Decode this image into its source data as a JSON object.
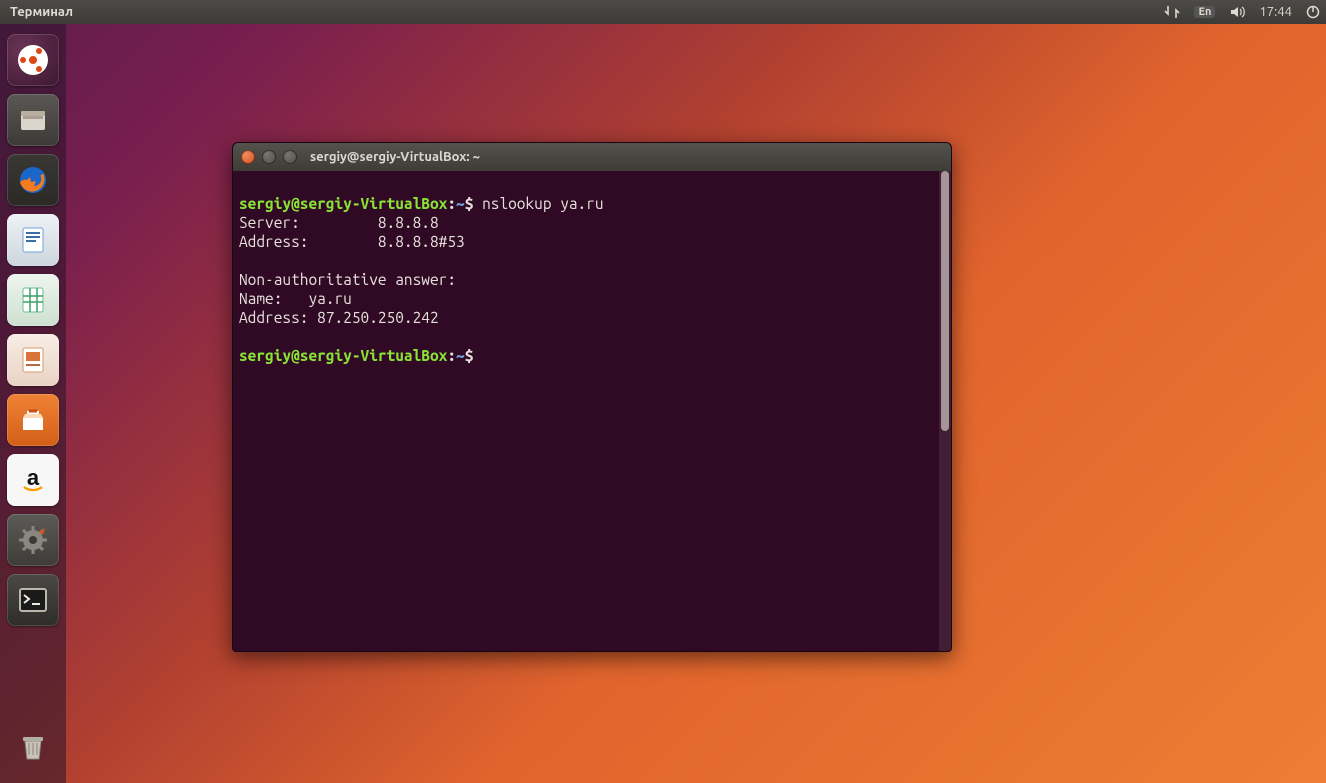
{
  "topbar": {
    "title": "Терминал",
    "lang": "En",
    "time": "17:44"
  },
  "launcher": {
    "items": [
      {
        "name": "dash",
        "label": "Dash"
      },
      {
        "name": "files",
        "label": "Files"
      },
      {
        "name": "firefox",
        "label": "Firefox"
      },
      {
        "name": "writer",
        "label": "LibreOffice Writer"
      },
      {
        "name": "calc",
        "label": "LibreOffice Calc"
      },
      {
        "name": "impress",
        "label": "LibreOffice Impress"
      },
      {
        "name": "software",
        "label": "Ubuntu Software"
      },
      {
        "name": "amazon",
        "label": "Amazon"
      },
      {
        "name": "settings",
        "label": "System Settings"
      },
      {
        "name": "terminal",
        "label": "Terminal"
      }
    ],
    "trash": "Trash"
  },
  "terminal": {
    "window_title": "sergiy@sergiy-VirtualBox: ~",
    "prompt_user": "sergiy@sergiy-VirtualBox",
    "prompt_sep1": ":",
    "prompt_path": "~",
    "prompt_sep2": "$",
    "command1": "nslookup ya.ru",
    "out_server": "Server:         8.8.8.8",
    "out_address1": "Address:        8.8.8.8#53",
    "out_blank1": "",
    "out_nonauth": "Non-authoritative answer:",
    "out_name": "Name:   ya.ru",
    "out_address2": "Address: 87.250.250.242",
    "out_blank2": ""
  }
}
